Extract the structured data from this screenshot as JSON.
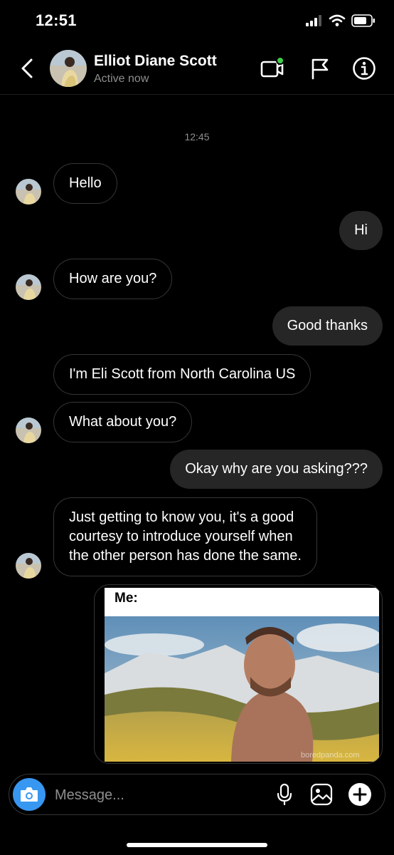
{
  "status_bar": {
    "time": "12:51"
  },
  "header": {
    "name": "Elliot Diane Scott",
    "status": "Active now"
  },
  "thread": {
    "timestamp": "12:45",
    "messages": [
      {
        "side": "in",
        "text": "Hello"
      },
      {
        "side": "out",
        "text": "Hi"
      },
      {
        "side": "in",
        "text": "How are you?"
      },
      {
        "side": "out",
        "text": "Good thanks"
      },
      {
        "side": "in",
        "text": "I'm Eli Scott from North Carolina US"
      },
      {
        "side": "in",
        "text": "What about you?"
      },
      {
        "side": "out",
        "text": "Okay why are you asking???"
      },
      {
        "side": "in",
        "lines": [
          "Just getting to know you, it's a good",
          "courtesy to introduce yourself when",
          "the other person has done the same."
        ]
      }
    ],
    "media": {
      "caption": "Me:",
      "watermark": "boredpanda.com"
    }
  },
  "composer": {
    "placeholder": "Message..."
  },
  "colors": {
    "accent": "#3897f0",
    "outgoing_bubble": "#262626",
    "online_dot": "#3ecf4a"
  }
}
